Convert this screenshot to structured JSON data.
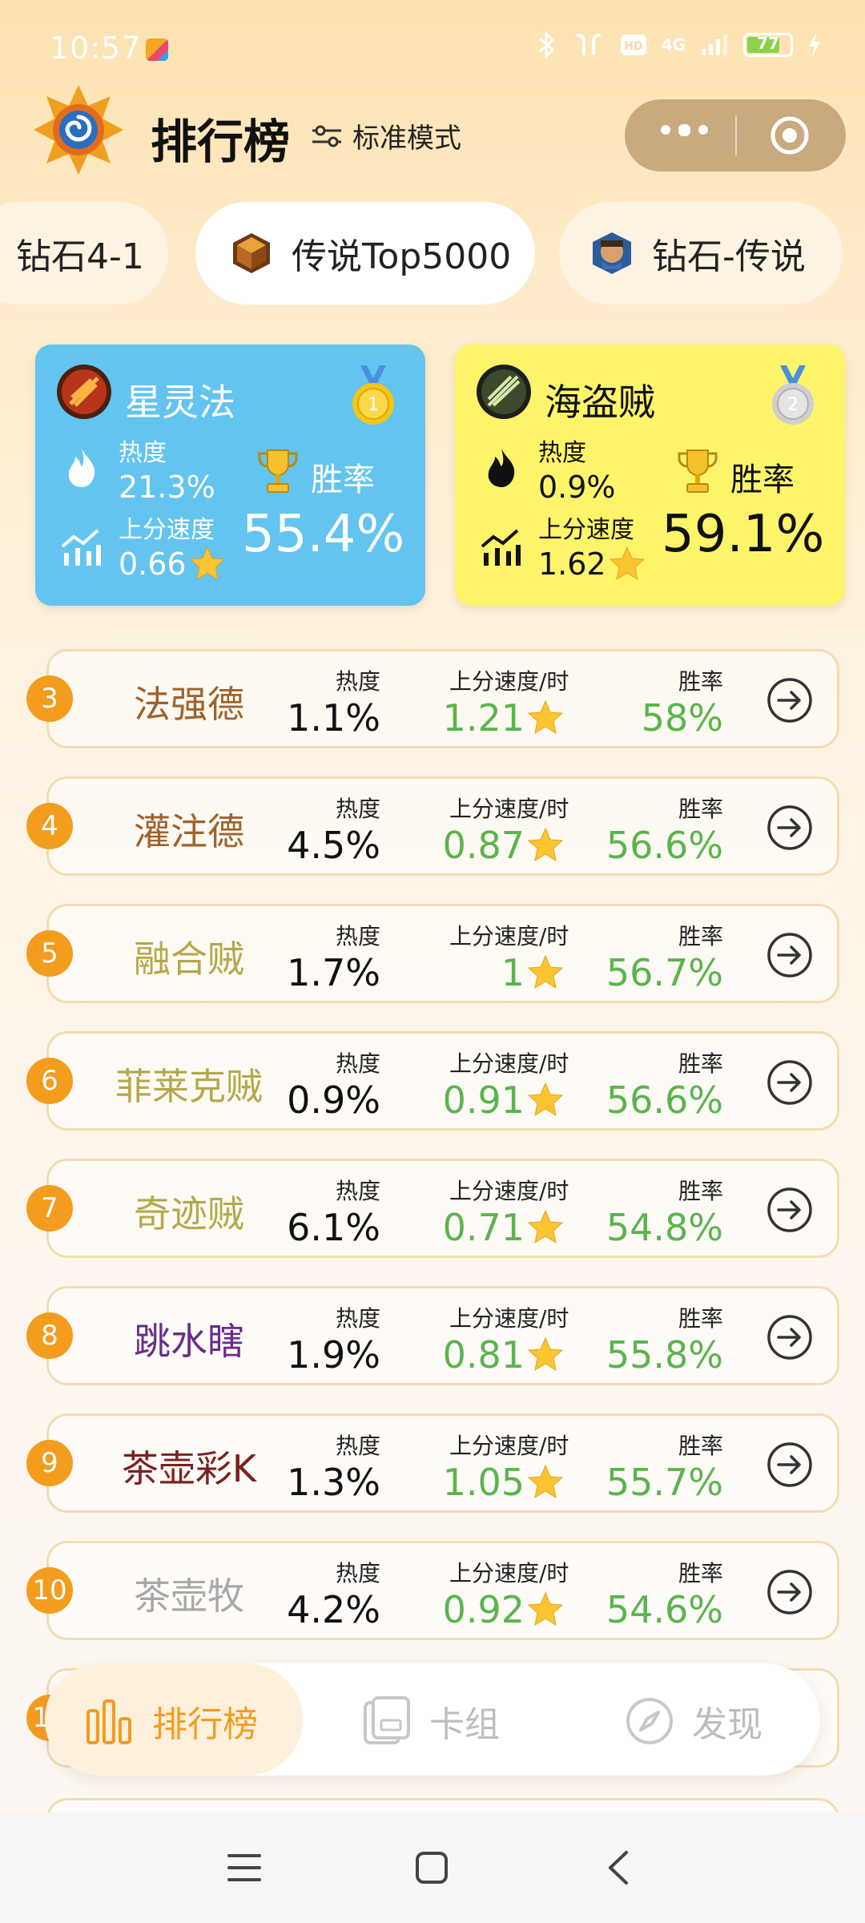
{
  "status_bar": {
    "time": "10:57",
    "network": "4G",
    "battery": "77",
    "battery_level": 0.77
  },
  "header": {
    "title": "排行榜",
    "mode_label": "标准模式"
  },
  "rank_tabs": [
    {
      "label": "钻石4-1",
      "active": false
    },
    {
      "label": "传说Top5000",
      "active": true
    },
    {
      "label": "钻石-传说",
      "active": false
    }
  ],
  "top_cards": [
    {
      "rank": "1",
      "name": "星灵法",
      "heat_label": "热度",
      "heat": "21.3%",
      "speed_label": "上分速度",
      "speed": "0.66",
      "winrate_label": "胜率",
      "winrate": "55.4%",
      "bg_color": "#62c4ef",
      "medal_color": "#f5c518"
    },
    {
      "rank": "2",
      "name": "海盗贼",
      "heat_label": "热度",
      "heat": "0.9%",
      "speed_label": "上分速度",
      "speed": "1.62",
      "winrate_label": "胜率",
      "winrate": "59.1%",
      "bg_color": "#fdf46a",
      "medal_color": "#c8c8c8"
    }
  ],
  "list_headers": {
    "heat": "热度",
    "speed": "上分速度/时",
    "winrate": "胜率"
  },
  "rows": [
    {
      "rank": "3",
      "name": "法强德",
      "heat": "1.1%",
      "speed": "1.21",
      "winrate": "58%",
      "name_color": "#a0612a"
    },
    {
      "rank": "4",
      "name": "灌注德",
      "heat": "4.5%",
      "speed": "0.87",
      "winrate": "56.6%",
      "name_color": "#a0612a"
    },
    {
      "rank": "5",
      "name": "融合贼",
      "heat": "1.7%",
      "speed": "1",
      "winrate": "56.7%",
      "name_color": "#b5a84a"
    },
    {
      "rank": "6",
      "name": "菲莱克贼",
      "heat": "0.9%",
      "speed": "0.91",
      "winrate": "56.6%",
      "name_color": "#b5a84a"
    },
    {
      "rank": "7",
      "name": "奇迹贼",
      "heat": "6.1%",
      "speed": "0.71",
      "winrate": "54.8%",
      "name_color": "#b5a84a"
    },
    {
      "rank": "8",
      "name": "跳水瞎",
      "heat": "1.9%",
      "speed": "0.81",
      "winrate": "55.8%",
      "name_color": "#6a2b8a"
    },
    {
      "rank": "9",
      "name": "茶壶彩K",
      "heat": "1.3%",
      "speed": "1.05",
      "winrate": "55.7%",
      "name_color": "#7a2020"
    },
    {
      "rank": "10",
      "name": "茶壶牧",
      "heat": "4.2%",
      "speed": "0.92",
      "winrate": "54.6%",
      "name_color": "#a8a8a8"
    }
  ],
  "partial_row": {
    "rank": "11"
  },
  "tab_bar": [
    {
      "label": "排行榜",
      "icon": "bar-chart-icon",
      "active": true
    },
    {
      "label": "卡组",
      "icon": "cards-icon",
      "active": false
    },
    {
      "label": "发现",
      "icon": "compass-icon",
      "active": false
    }
  ],
  "icons": {
    "heat": "fire-icon",
    "speed": "rising-chart-icon",
    "winrate": "trophy-icon",
    "detail": "arrow-circle-icon"
  },
  "colors": {
    "accent": "#f39c1e",
    "positive": "#5ab44d",
    "capsule": "#c9a97e"
  }
}
